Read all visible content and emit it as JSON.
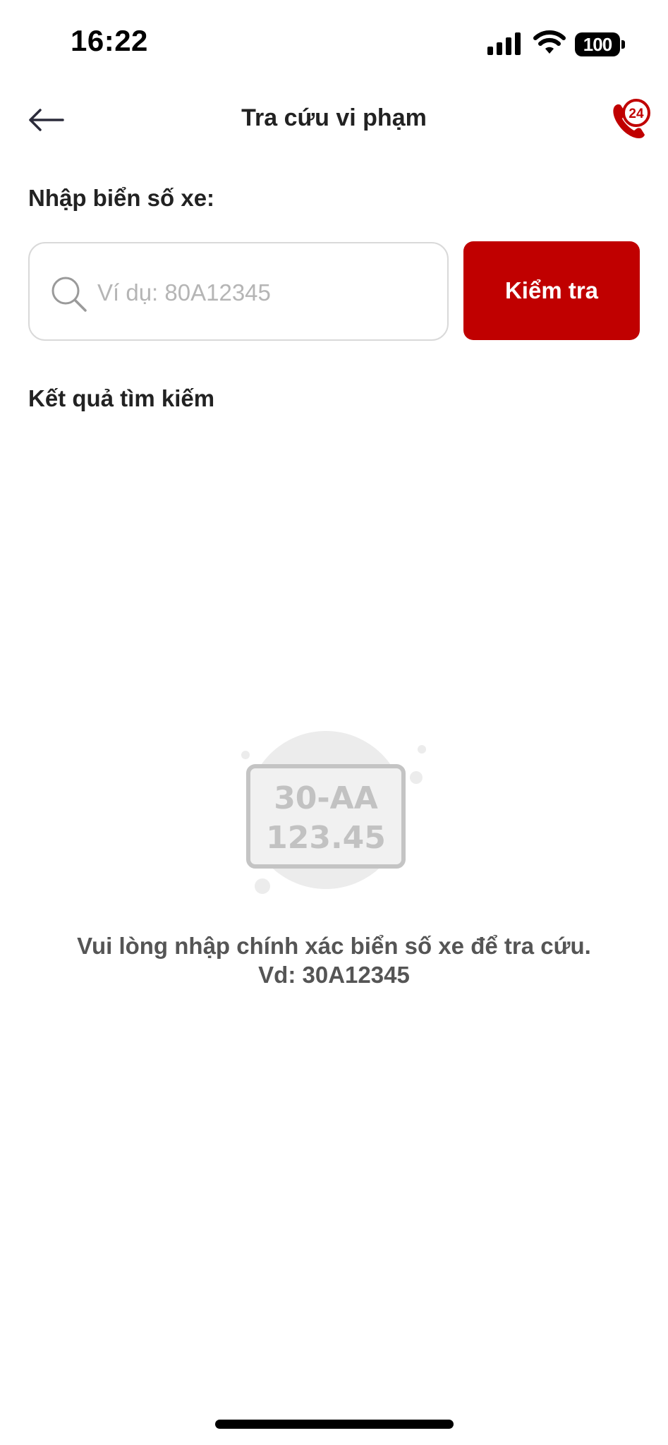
{
  "status_bar": {
    "time": "16:22",
    "battery": "100"
  },
  "header": {
    "title": "Tra cứu vi phạm"
  },
  "form": {
    "label": "Nhập biển số xe:",
    "placeholder": "Ví dụ: 80A12345",
    "value": "",
    "button_label": "Kiểm tra"
  },
  "results": {
    "heading": "Kết quả tìm kiếm",
    "illustration_plate_line1": "30-AA",
    "illustration_plate_line2": "123.45",
    "empty_message_line1": "Vui lòng nhập chính xác biển số xe để tra cứu.",
    "empty_message_line2": "Vd: 30A12345"
  },
  "colors": {
    "accent": "#c00000",
    "text": "#222222",
    "muted_text": "#555555",
    "placeholder": "#b5b5b5",
    "border": "#d9d9d9"
  },
  "icons": {
    "back": "arrow-left-icon",
    "hotline": "phone-24-icon",
    "search": "search-icon"
  }
}
